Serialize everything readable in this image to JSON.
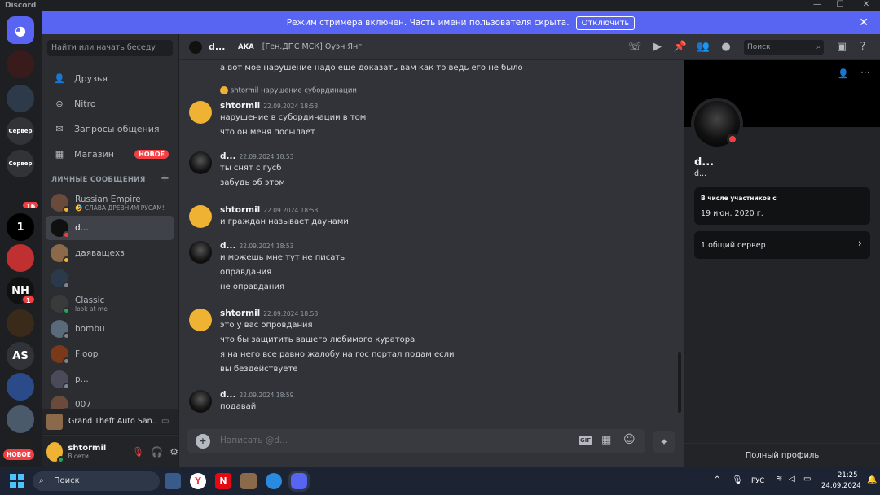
{
  "app": {
    "title": "Discord"
  },
  "banner": {
    "text": "Режим стримера включен. Часть имени пользователя скрыта.",
    "button": "Отключить"
  },
  "guilds": {
    "items": [
      {
        "label": "",
        "color": "#5865f2"
      },
      {
        "label": "",
        "color": "#3a1b1b"
      },
      {
        "label": "",
        "color": "#2d3a4a"
      },
      {
        "label": "Сервер",
        "color": "#313338"
      },
      {
        "label": "Сервер",
        "color": "#313338"
      },
      {
        "label": "",
        "color": "#1e1f22",
        "badge": "16"
      },
      {
        "label": "1",
        "color": "#000000"
      },
      {
        "label": "",
        "color": "#c03030"
      },
      {
        "label": "NH",
        "color": "#111111",
        "badge": "1"
      },
      {
        "label": "",
        "color": "#3a2a1a"
      },
      {
        "label": "AS",
        "color": "#313338"
      },
      {
        "label": "",
        "color": "#2a4a8a"
      },
      {
        "label": "",
        "color": "#4a5a6a"
      },
      {
        "label": "",
        "color": "#202020"
      }
    ],
    "new_label": "НОВОЕ"
  },
  "dm_sidebar": {
    "search_placeholder": "Найти или начать беседу",
    "nav": [
      {
        "label": "Друзья",
        "icon": "friends-icon"
      },
      {
        "label": "Nitro",
        "icon": "nitro-icon"
      },
      {
        "label": "Запросы общения",
        "icon": "mail-icon"
      },
      {
        "label": "Магазин",
        "icon": "shop-icon",
        "badge": "НОВОЕ"
      }
    ],
    "header": "ЛИЧНЫЕ СООБЩЕНИЯ",
    "dms": [
      {
        "name": "Russian Empire",
        "sub": "🤣 СЛАВА ДРЕВНИМ РУСАМ!",
        "color": "#6a4a3a",
        "status": "#f0b232"
      },
      {
        "name": "d...",
        "sub": "",
        "color": "#101010",
        "status": "#f23f43",
        "active": true
      },
      {
        "name": "даяващехз",
        "sub": "",
        "color": "#8a6a4a",
        "status": "#f0b232"
      },
      {
        "name": "",
        "sub": "",
        "color": "#2a3a4a",
        "status": "#80848e"
      },
      {
        "name": "Classic",
        "sub": "look at me",
        "color": "#3a3a3a",
        "status": "#23a55a"
      },
      {
        "name": "bombu",
        "sub": "",
        "color": "#5a6a7a",
        "status": "#80848e"
      },
      {
        "name": "Floop",
        "sub": "",
        "color": "#7a3a1a",
        "status": "#80848e"
      },
      {
        "name": "p...",
        "sub": "",
        "color": "#4a4a5a",
        "status": "#80848e"
      },
      {
        "name": "007",
        "sub": "",
        "color": "#6a4a3a",
        "status": "#80848e"
      }
    ],
    "activity": "Grand Theft Auto San...",
    "user": {
      "name": "shtormil",
      "status": "В сети"
    }
  },
  "chat": {
    "header": {
      "name": "d...",
      "aka": "AKA",
      "aka_value": "[Ген.ДПС МСК] Оуэн Янг",
      "search_placeholder": "Поиск"
    },
    "top_line": "а вот мое нарушение надо еще доказать вам как то ведь его не было",
    "reply": {
      "author": "shtormil",
      "text": "нарушение субординации"
    },
    "messages": [
      {
        "author": "shtormil",
        "time": "22.09.2024 18:53",
        "lines": [
          "нарушение в субординации в том",
          "что он меня посылает"
        ],
        "self": true
      },
      {
        "author": "d...",
        "time": "22.09.2024 18:53",
        "lines": [
          "ты снят с гусб",
          "забудь об этом"
        ],
        "self": false
      },
      {
        "author": "shtormil",
        "time": "22.09.2024 18:53",
        "lines": [
          "и граждан называет даунами"
        ],
        "self": true
      },
      {
        "author": "d...",
        "time": "22.09.2024 18:53",
        "lines": [
          "и можешь мне тут не писать",
          "оправдания",
          "не оправдания"
        ],
        "self": false
      },
      {
        "author": "shtormil",
        "time": "22.09.2024 18:53",
        "lines": [
          "это у вас опровдания",
          "что бы защитить вашего любимого куратора",
          "я на него все равно жалобу на гос портал подам если",
          "вы бездействуете"
        ],
        "self": true
      },
      {
        "author": "d...",
        "time": "22.09.2024 18:59",
        "lines": [
          "подавай"
        ],
        "self": false
      }
    ],
    "composer_placeholder": "Написать @d...",
    "gif_label": "GIF"
  },
  "profile": {
    "name": "d...",
    "username": "d...",
    "member_since_label": "В числе участников с",
    "member_since": "19 июн. 2020 г.",
    "mutual": "1 общий сервер",
    "full_profile": "Полный профиль"
  },
  "taskbar": {
    "search": "Поиск",
    "lang": "РУС",
    "time": "21:25",
    "date": "24.09.2024"
  }
}
